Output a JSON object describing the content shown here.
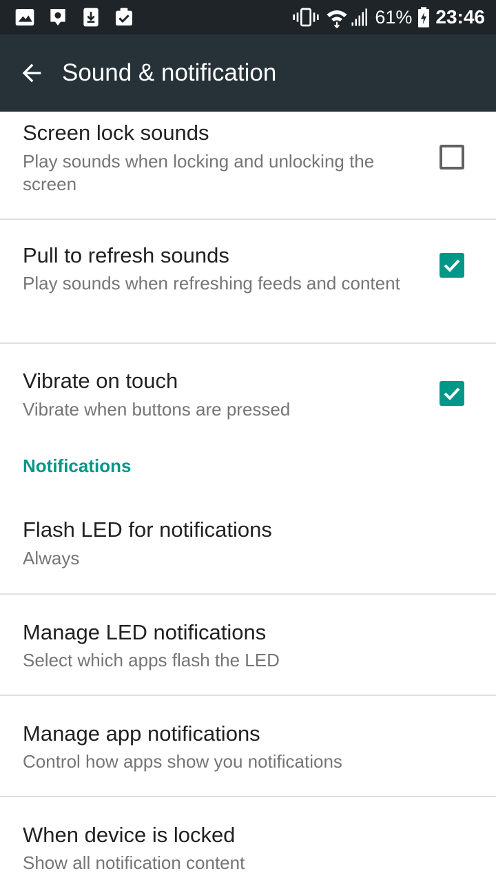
{
  "status_bar": {
    "icons_left": [
      "image-icon",
      "location-icon",
      "download-icon",
      "task-check-icon"
    ],
    "icons_right": [
      "vibrate-icon",
      "wifi-icon",
      "signal-icon",
      "battery-icon"
    ],
    "battery": "61%",
    "time": "23:46"
  },
  "app_bar": {
    "title": "Sound & notification",
    "back_icon": "arrow-back-icon"
  },
  "preferences": [
    {
      "title": "Screen lock sounds",
      "summary": "Play sounds when locking and unlocking the screen",
      "checked": false
    },
    {
      "title": "Pull to refresh sounds",
      "summary": "Play sounds when refreshing feeds and content",
      "checked": true
    },
    {
      "title": "Vibrate on touch",
      "summary": "Vibrate when buttons are pressed",
      "checked": true
    }
  ],
  "notifications_section": {
    "header": "Notifications",
    "items": [
      {
        "title": "Flash LED for notifications",
        "summary": "Always"
      },
      {
        "title": "Manage LED notifications",
        "summary": "Select which apps flash the LED"
      },
      {
        "title": "Manage app notifications",
        "summary": "Control how apps show you notifications"
      },
      {
        "title": "When device is locked",
        "summary": "Show all notification content"
      }
    ]
  },
  "colors": {
    "status_bar": "#1f2428",
    "app_bar": "#263238",
    "accent": "#009688",
    "title_text": "#212121",
    "summary_text": "#757575",
    "divider": "#e0e0e0"
  }
}
